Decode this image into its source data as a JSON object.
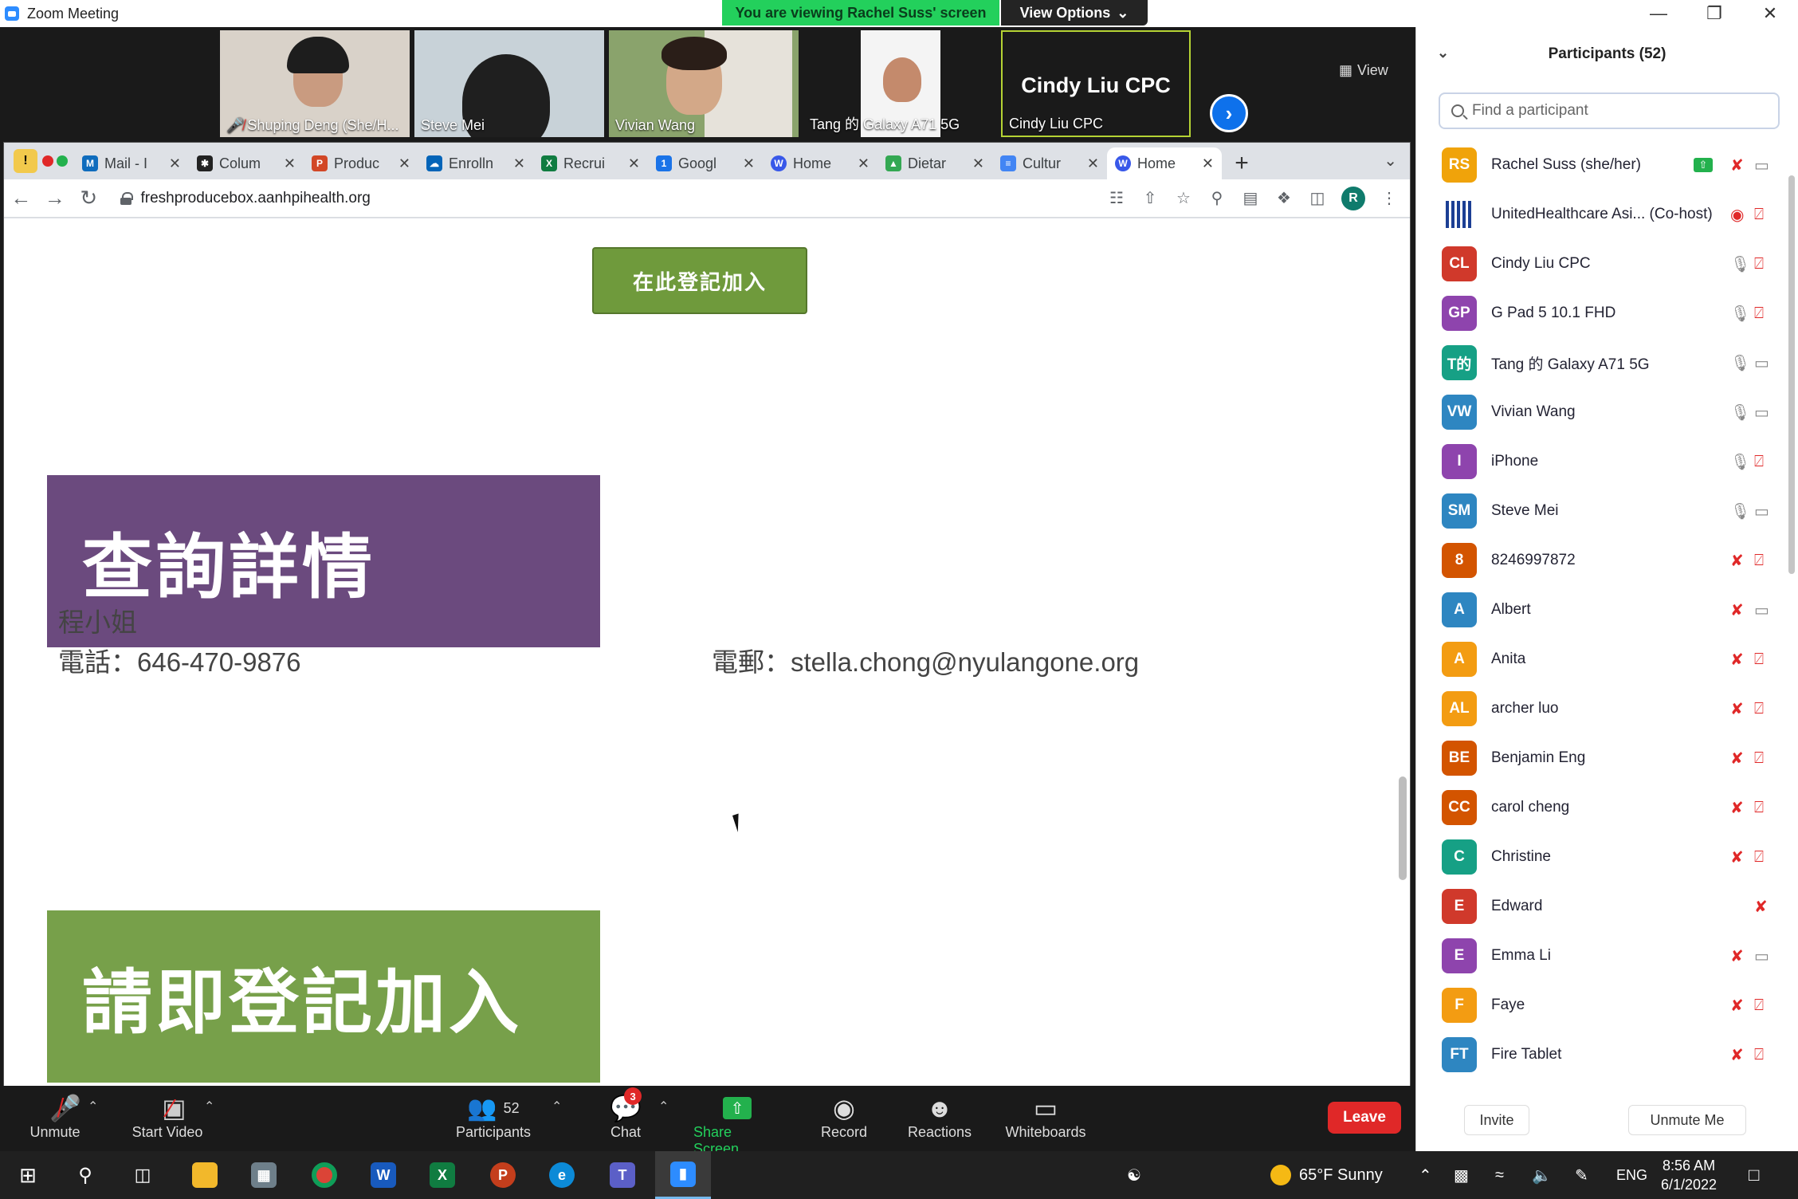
{
  "window": {
    "title": "Zoom Meeting",
    "viewing_banner": "You are viewing Rachel Suss' screen",
    "view_options": "View Options",
    "view_label": "View"
  },
  "video_tiles": [
    {
      "name": "Shuping Deng (She/H...",
      "muted": true
    },
    {
      "name": "Steve Mei",
      "muted": false
    },
    {
      "name": "Vivian Wang",
      "muted": false
    },
    {
      "name": "Tang 的 Galaxy A71 5G",
      "muted": false
    },
    {
      "name": "Cindy Liu CPC",
      "muted": false,
      "big_label": "Cindy Liu CPC"
    }
  ],
  "browser": {
    "recording_label": "Recording",
    "tabs": [
      {
        "label": "Mail - I",
        "icon_color": "#0f6cbd"
      },
      {
        "label": "Colum",
        "icon_color": "#222222"
      },
      {
        "label": "Produc",
        "icon_color": "#d24726"
      },
      {
        "label": "Enrolln",
        "icon_color": "#0364b8"
      },
      {
        "label": "Recrui",
        "icon_color": "#107c41"
      },
      {
        "label": "Googl",
        "icon_color": "#1a73e8"
      },
      {
        "label": "Home",
        "icon_color": "#3858e9"
      },
      {
        "label": "Dietar",
        "icon_color": "#34a853"
      },
      {
        "label": "Cultur",
        "icon_color": "#4285f4"
      },
      {
        "label": "Home",
        "icon_color": "#3858e9",
        "active": true
      }
    ],
    "url": "freshproducebox.aanhpihealth.org",
    "profile_initial": "R"
  },
  "page": {
    "register_button": "在此登記加入",
    "banner_details": "查詢詳情",
    "contact_name": "程小姐",
    "contact_phone": "電話：646-470-9876",
    "contact_email": "電郵：stella.chong@nyulangone.org",
    "banner_register": "請即登記加入"
  },
  "participants": {
    "title": "Participants (52)",
    "search_placeholder": "Find a participant",
    "list": [
      {
        "initials": "RS",
        "name": "Rachel Suss (she/her)",
        "color": "#f0a30a",
        "mic": "off",
        "cam": "on",
        "sharing": true
      },
      {
        "initials": "",
        "name": "UnitedHealthcare Asi...  (Co-host)",
        "color": "#1c3f94",
        "mic": "rec",
        "cam": "off",
        "logo": true
      },
      {
        "initials": "CL",
        "name": "Cindy Liu CPC",
        "color": "#d0392b",
        "mic": "on",
        "cam": "off"
      },
      {
        "initials": "GP",
        "name": "G Pad 5 10.1 FHD",
        "color": "#8e44ad",
        "mic": "on",
        "cam": "off"
      },
      {
        "initials": "T的",
        "name": "Tang 的 Galaxy A71 5G",
        "color": "#16a085",
        "mic": "on",
        "cam": "on"
      },
      {
        "initials": "VW",
        "name": "Vivian Wang",
        "color": "#2e86c1",
        "mic": "on",
        "cam": "on"
      },
      {
        "initials": "I",
        "name": "iPhone",
        "color": "#8e44ad",
        "mic": "on",
        "cam": "off"
      },
      {
        "initials": "SM",
        "name": "Steve Mei",
        "color": "#2e86c1",
        "mic": "on",
        "cam": "on"
      },
      {
        "initials": "8",
        "name": "8246997872",
        "color": "#d35400",
        "mic": "off",
        "cam": "off"
      },
      {
        "initials": "A",
        "name": "Albert",
        "color": "#2e86c1",
        "mic": "off",
        "cam": "on"
      },
      {
        "initials": "A",
        "name": "Anita",
        "color": "#f39c12",
        "mic": "off",
        "cam": "off"
      },
      {
        "initials": "AL",
        "name": "archer luo",
        "color": "#f39c12",
        "mic": "off",
        "cam": "off"
      },
      {
        "initials": "BE",
        "name": "Benjamin Eng",
        "color": "#d35400",
        "mic": "off",
        "cam": "off"
      },
      {
        "initials": "CC",
        "name": "carol cheng",
        "color": "#d35400",
        "mic": "off",
        "cam": "off"
      },
      {
        "initials": "C",
        "name": "Christine",
        "color": "#16a085",
        "mic": "off",
        "cam": "off"
      },
      {
        "initials": "E",
        "name": "Edward",
        "color": "#d0392b",
        "mic": "off",
        "cam": "none"
      },
      {
        "initials": "E",
        "name": "Emma Li",
        "color": "#8e44ad",
        "mic": "off",
        "cam": "on"
      },
      {
        "initials": "F",
        "name": "Faye",
        "color": "#f39c12",
        "mic": "off",
        "cam": "off"
      },
      {
        "initials": "FT",
        "name": "Fire Tablet",
        "color": "#2e86c1",
        "mic": "off",
        "cam": "off"
      }
    ],
    "invite_label": "Invite",
    "unmute_me_label": "Unmute Me"
  },
  "controls": {
    "unmute": "Unmute",
    "start_video": "Start Video",
    "participants_label": "Participants",
    "participants_count": "52",
    "chat": "Chat",
    "chat_badge": "3",
    "share_screen": "Share Screen",
    "record": "Record",
    "reactions": "Reactions",
    "whiteboards": "Whiteboards",
    "leave": "Leave"
  },
  "taskbar": {
    "weather": "65°F  Sunny",
    "language": "ENG",
    "time": "8:56 AM",
    "date": "6/1/2022"
  }
}
